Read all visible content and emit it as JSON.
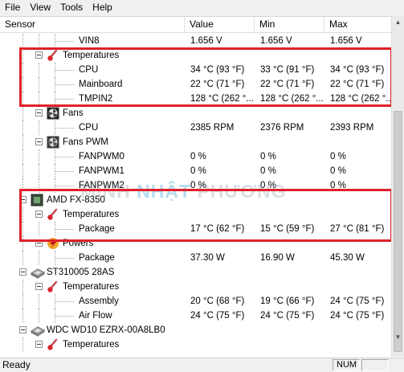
{
  "menu": [
    "File",
    "View",
    "Tools",
    "Help"
  ],
  "columns": [
    "Sensor",
    "Value",
    "Min",
    "Max"
  ],
  "rows": [
    {
      "label": "VIN8",
      "level": 3,
      "value": "1.656 V",
      "min": "1.656 V",
      "max": "1.656 V"
    },
    {
      "label": "Temperatures",
      "level": 2,
      "icon": "thermometer-icon",
      "expander": true
    },
    {
      "label": "CPU",
      "level": 3,
      "value": "34 °C  (93 °F)",
      "min": "33 °C  (91 °F)",
      "max": "34 °C  (93 °F)"
    },
    {
      "label": "Mainboard",
      "level": 3,
      "value": "22 °C  (71 °F)",
      "min": "22 °C  (71 °F)",
      "max": "22 °C  (71 °F)"
    },
    {
      "label": "TMPIN2",
      "level": 3,
      "value": "128 °C  (262 °...",
      "min": "128 °C  (262 °...",
      "max": "128 °C  (262 °..."
    },
    {
      "label": "Fans",
      "level": 2,
      "icon": "fan-icon",
      "expander": true
    },
    {
      "label": "CPU",
      "level": 3,
      "value": "2385 RPM",
      "min": "2376 RPM",
      "max": "2393 RPM"
    },
    {
      "label": "Fans PWM",
      "level": 2,
      "icon": "fan-pwm-icon",
      "expander": true
    },
    {
      "label": "FANPWM0",
      "level": 3,
      "value": "0 %",
      "min": "0 %",
      "max": "0 %"
    },
    {
      "label": "FANPWM1",
      "level": 3,
      "value": "0 %",
      "min": "0 %",
      "max": "0 %"
    },
    {
      "label": "FANPWM2",
      "level": 3,
      "value": "0 %",
      "min": "0 %",
      "max": "0 %"
    },
    {
      "label": "AMD FX-8350",
      "level": 1,
      "icon": "cpu-chip-icon",
      "expander": true
    },
    {
      "label": "Temperatures",
      "level": 2,
      "icon": "thermometer-icon",
      "expander": true
    },
    {
      "label": "Package",
      "level": 3,
      "value": "17 °C  (62 °F)",
      "min": "15 °C  (59 °F)",
      "max": "27 °C  (81 °F)"
    },
    {
      "label": "Powers",
      "level": 2,
      "icon": "power-icon",
      "expander": true
    },
    {
      "label": "Package",
      "level": 3,
      "value": "37.30 W",
      "min": "16.90 W",
      "max": "45.30 W"
    },
    {
      "label": "ST310005 28AS",
      "level": 1,
      "icon": "hard-disk-icon",
      "expander": true
    },
    {
      "label": "Temperatures",
      "level": 2,
      "icon": "thermometer-icon",
      "expander": true
    },
    {
      "label": "Assembly",
      "level": 3,
      "value": "20 °C  (68 °F)",
      "min": "19 °C  (66 °F)",
      "max": "24 °C  (75 °F)"
    },
    {
      "label": "Air Flow",
      "level": 3,
      "value": "24 °C  (75 °F)",
      "min": "24 °C  (75 °F)",
      "max": "24 °C  (75 °F)"
    },
    {
      "label": "WDC WD10 EZRX-00A8LB0",
      "level": 1,
      "icon": "hard-disk-icon",
      "expander": true
    },
    {
      "label": "Temperatures",
      "level": 2,
      "icon": "thermometer-icon",
      "expander": true
    }
  ],
  "watermark": {
    "part1": "MINH ",
    "part2": "NHẬT",
    "part3": " PHƯƠNG"
  },
  "status": {
    "text": "Ready",
    "num": "NUM"
  },
  "colors": {
    "highlight": "#e0202a",
    "thermometer": "#d8262b"
  }
}
